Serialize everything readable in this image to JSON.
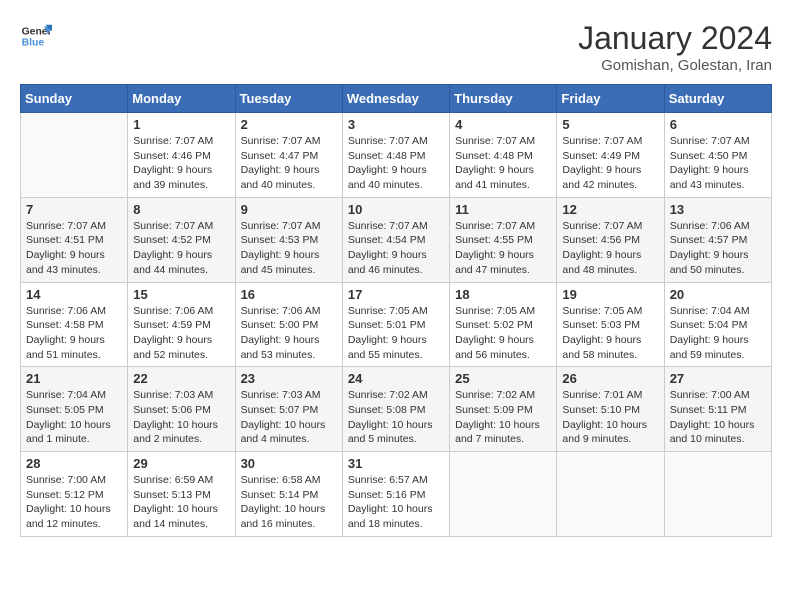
{
  "header": {
    "logo_line1": "General",
    "logo_line2": "Blue",
    "month_year": "January 2024",
    "location": "Gomishan, Golestan, Iran"
  },
  "weekdays": [
    "Sunday",
    "Monday",
    "Tuesday",
    "Wednesday",
    "Thursday",
    "Friday",
    "Saturday"
  ],
  "weeks": [
    [
      {
        "day": "",
        "sunrise": "",
        "sunset": "",
        "daylight": ""
      },
      {
        "day": "1",
        "sunrise": "Sunrise: 7:07 AM",
        "sunset": "Sunset: 4:46 PM",
        "daylight": "Daylight: 9 hours and 39 minutes."
      },
      {
        "day": "2",
        "sunrise": "Sunrise: 7:07 AM",
        "sunset": "Sunset: 4:47 PM",
        "daylight": "Daylight: 9 hours and 40 minutes."
      },
      {
        "day": "3",
        "sunrise": "Sunrise: 7:07 AM",
        "sunset": "Sunset: 4:48 PM",
        "daylight": "Daylight: 9 hours and 40 minutes."
      },
      {
        "day": "4",
        "sunrise": "Sunrise: 7:07 AM",
        "sunset": "Sunset: 4:48 PM",
        "daylight": "Daylight: 9 hours and 41 minutes."
      },
      {
        "day": "5",
        "sunrise": "Sunrise: 7:07 AM",
        "sunset": "Sunset: 4:49 PM",
        "daylight": "Daylight: 9 hours and 42 minutes."
      },
      {
        "day": "6",
        "sunrise": "Sunrise: 7:07 AM",
        "sunset": "Sunset: 4:50 PM",
        "daylight": "Daylight: 9 hours and 43 minutes."
      }
    ],
    [
      {
        "day": "7",
        "sunrise": "Sunrise: 7:07 AM",
        "sunset": "Sunset: 4:51 PM",
        "daylight": "Daylight: 9 hours and 43 minutes."
      },
      {
        "day": "8",
        "sunrise": "Sunrise: 7:07 AM",
        "sunset": "Sunset: 4:52 PM",
        "daylight": "Daylight: 9 hours and 44 minutes."
      },
      {
        "day": "9",
        "sunrise": "Sunrise: 7:07 AM",
        "sunset": "Sunset: 4:53 PM",
        "daylight": "Daylight: 9 hours and 45 minutes."
      },
      {
        "day": "10",
        "sunrise": "Sunrise: 7:07 AM",
        "sunset": "Sunset: 4:54 PM",
        "daylight": "Daylight: 9 hours and 46 minutes."
      },
      {
        "day": "11",
        "sunrise": "Sunrise: 7:07 AM",
        "sunset": "Sunset: 4:55 PM",
        "daylight": "Daylight: 9 hours and 47 minutes."
      },
      {
        "day": "12",
        "sunrise": "Sunrise: 7:07 AM",
        "sunset": "Sunset: 4:56 PM",
        "daylight": "Daylight: 9 hours and 48 minutes."
      },
      {
        "day": "13",
        "sunrise": "Sunrise: 7:06 AM",
        "sunset": "Sunset: 4:57 PM",
        "daylight": "Daylight: 9 hours and 50 minutes."
      }
    ],
    [
      {
        "day": "14",
        "sunrise": "Sunrise: 7:06 AM",
        "sunset": "Sunset: 4:58 PM",
        "daylight": "Daylight: 9 hours and 51 minutes."
      },
      {
        "day": "15",
        "sunrise": "Sunrise: 7:06 AM",
        "sunset": "Sunset: 4:59 PM",
        "daylight": "Daylight: 9 hours and 52 minutes."
      },
      {
        "day": "16",
        "sunrise": "Sunrise: 7:06 AM",
        "sunset": "Sunset: 5:00 PM",
        "daylight": "Daylight: 9 hours and 53 minutes."
      },
      {
        "day": "17",
        "sunrise": "Sunrise: 7:05 AM",
        "sunset": "Sunset: 5:01 PM",
        "daylight": "Daylight: 9 hours and 55 minutes."
      },
      {
        "day": "18",
        "sunrise": "Sunrise: 7:05 AM",
        "sunset": "Sunset: 5:02 PM",
        "daylight": "Daylight: 9 hours and 56 minutes."
      },
      {
        "day": "19",
        "sunrise": "Sunrise: 7:05 AM",
        "sunset": "Sunset: 5:03 PM",
        "daylight": "Daylight: 9 hours and 58 minutes."
      },
      {
        "day": "20",
        "sunrise": "Sunrise: 7:04 AM",
        "sunset": "Sunset: 5:04 PM",
        "daylight": "Daylight: 9 hours and 59 minutes."
      }
    ],
    [
      {
        "day": "21",
        "sunrise": "Sunrise: 7:04 AM",
        "sunset": "Sunset: 5:05 PM",
        "daylight": "Daylight: 10 hours and 1 minute."
      },
      {
        "day": "22",
        "sunrise": "Sunrise: 7:03 AM",
        "sunset": "Sunset: 5:06 PM",
        "daylight": "Daylight: 10 hours and 2 minutes."
      },
      {
        "day": "23",
        "sunrise": "Sunrise: 7:03 AM",
        "sunset": "Sunset: 5:07 PM",
        "daylight": "Daylight: 10 hours and 4 minutes."
      },
      {
        "day": "24",
        "sunrise": "Sunrise: 7:02 AM",
        "sunset": "Sunset: 5:08 PM",
        "daylight": "Daylight: 10 hours and 5 minutes."
      },
      {
        "day": "25",
        "sunrise": "Sunrise: 7:02 AM",
        "sunset": "Sunset: 5:09 PM",
        "daylight": "Daylight: 10 hours and 7 minutes."
      },
      {
        "day": "26",
        "sunrise": "Sunrise: 7:01 AM",
        "sunset": "Sunset: 5:10 PM",
        "daylight": "Daylight: 10 hours and 9 minutes."
      },
      {
        "day": "27",
        "sunrise": "Sunrise: 7:00 AM",
        "sunset": "Sunset: 5:11 PM",
        "daylight": "Daylight: 10 hours and 10 minutes."
      }
    ],
    [
      {
        "day": "28",
        "sunrise": "Sunrise: 7:00 AM",
        "sunset": "Sunset: 5:12 PM",
        "daylight": "Daylight: 10 hours and 12 minutes."
      },
      {
        "day": "29",
        "sunrise": "Sunrise: 6:59 AM",
        "sunset": "Sunset: 5:13 PM",
        "daylight": "Daylight: 10 hours and 14 minutes."
      },
      {
        "day": "30",
        "sunrise": "Sunrise: 6:58 AM",
        "sunset": "Sunset: 5:14 PM",
        "daylight": "Daylight: 10 hours and 16 minutes."
      },
      {
        "day": "31",
        "sunrise": "Sunrise: 6:57 AM",
        "sunset": "Sunset: 5:16 PM",
        "daylight": "Daylight: 10 hours and 18 minutes."
      },
      {
        "day": "",
        "sunrise": "",
        "sunset": "",
        "daylight": ""
      },
      {
        "day": "",
        "sunrise": "",
        "sunset": "",
        "daylight": ""
      },
      {
        "day": "",
        "sunrise": "",
        "sunset": "",
        "daylight": ""
      }
    ]
  ]
}
